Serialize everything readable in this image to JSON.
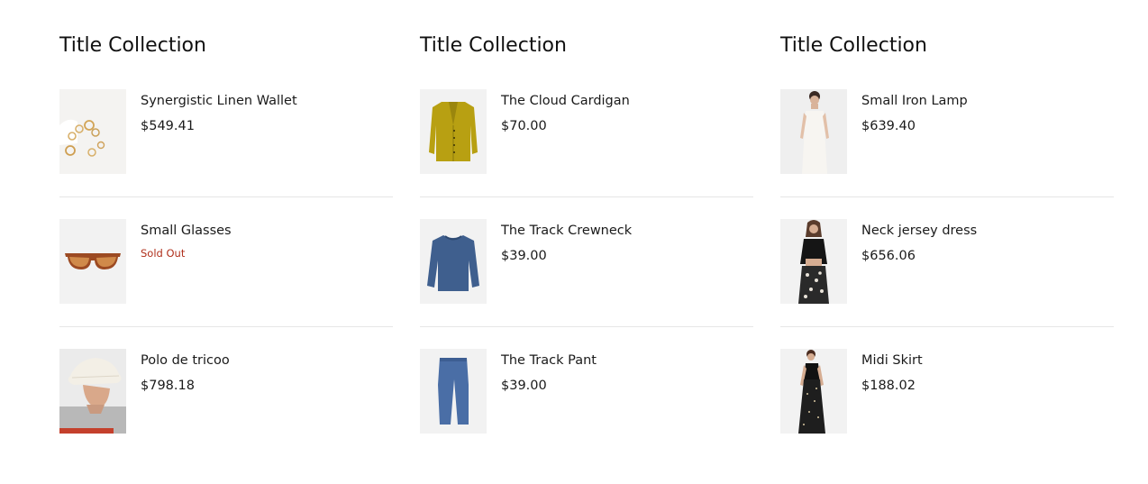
{
  "collections": [
    {
      "title": "Title Collection",
      "products": [
        {
          "name": "Synergistic Linen Wallet",
          "price": "$549.41",
          "image_icon": "gold-rings-image"
        },
        {
          "name": "Small Glasses",
          "status": "Sold Out",
          "image_icon": "sunglasses-image"
        },
        {
          "name": "Polo de tricoo",
          "price": "$798.18",
          "image_icon": "man-bucket-hat-image"
        }
      ]
    },
    {
      "title": "Title Collection",
      "products": [
        {
          "name": "The Cloud Cardigan",
          "price": "$70.00",
          "image_icon": "yellow-cardigan-image"
        },
        {
          "name": "The Track Crewneck",
          "price": "$39.00",
          "image_icon": "blue-crewneck-image"
        },
        {
          "name": "The Track Pant",
          "price": "$39.00",
          "image_icon": "blue-track-pant-image"
        }
      ]
    },
    {
      "title": "Title Collection",
      "products": [
        {
          "name": "Small Iron Lamp",
          "price": "$639.40",
          "image_icon": "woman-white-dress-image"
        },
        {
          "name": "Neck jersey dress",
          "price": "$656.06",
          "image_icon": "woman-black-top-floral-skirt-image"
        },
        {
          "name": "Midi Skirt",
          "price": "$188.02",
          "image_icon": "woman-black-midi-skirt-image"
        }
      ]
    }
  ],
  "colors": {
    "sold_out": "#b0301c",
    "thumb_bg": "#f2f2f2",
    "divider": "#e6e6e6"
  }
}
